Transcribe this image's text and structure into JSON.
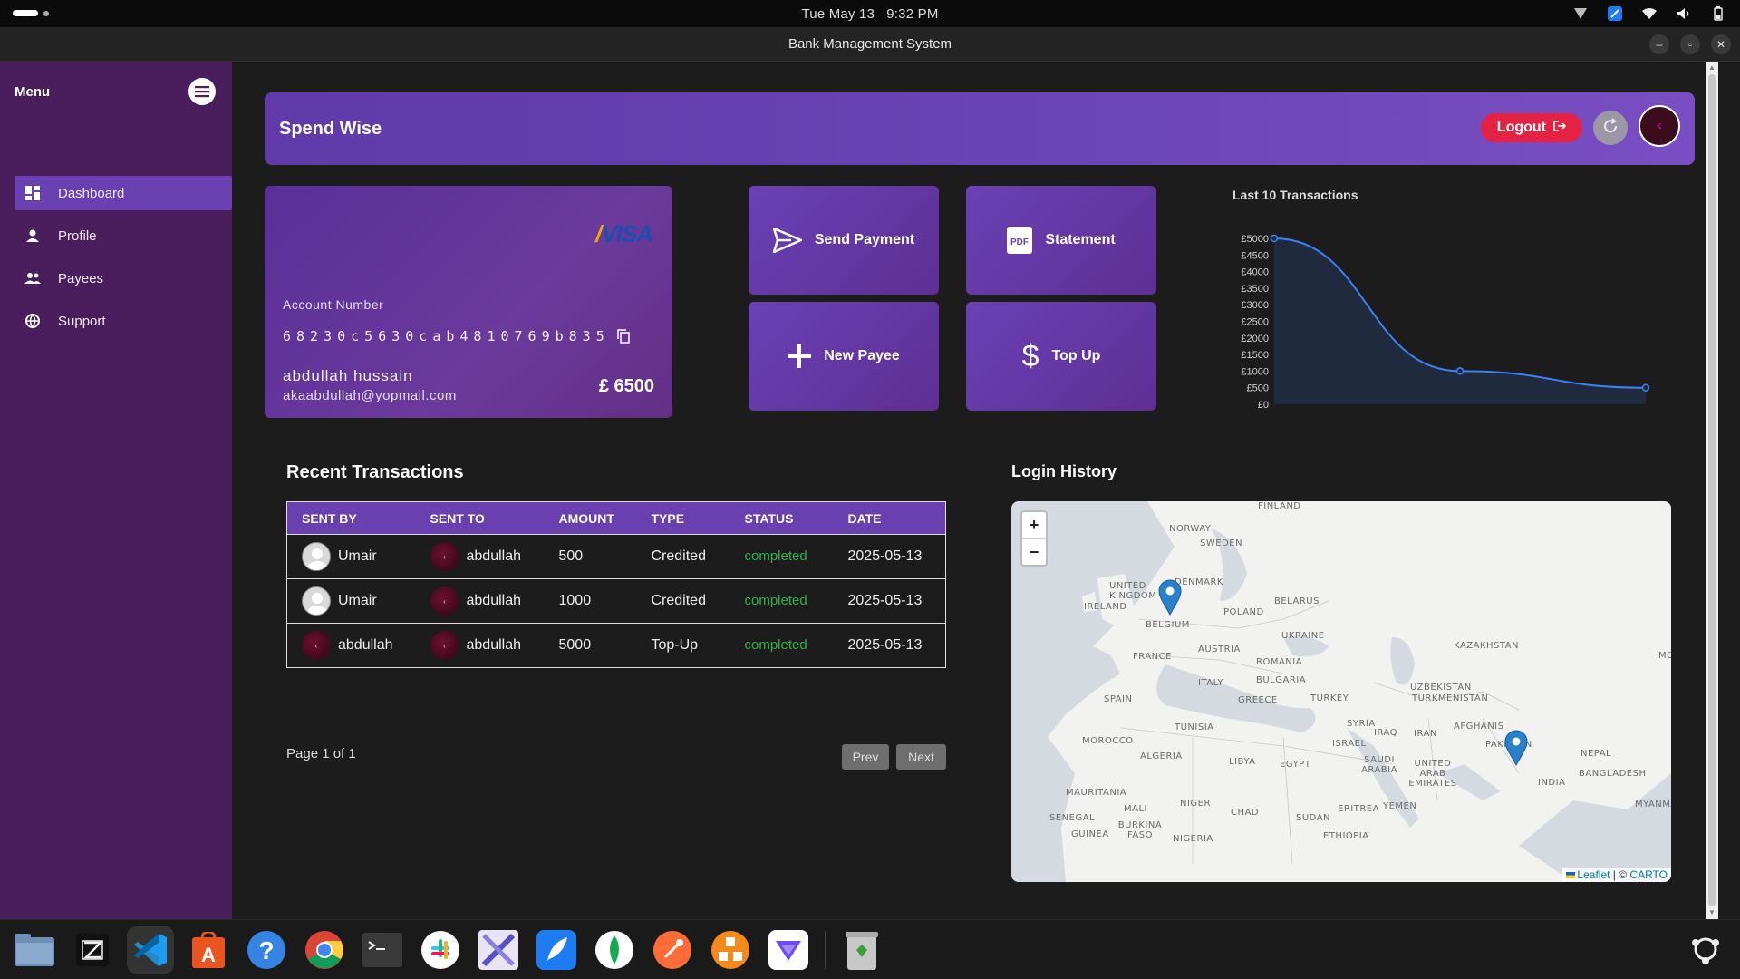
{
  "system": {
    "clock_date": "Tue May 13",
    "clock_time": "9:32 PM"
  },
  "window": {
    "title": "Bank Management System"
  },
  "sidebar": {
    "menu_label": "Menu",
    "items": [
      {
        "label": "Dashboard",
        "icon": "dashboard-icon",
        "active": true
      },
      {
        "label": "Profile",
        "icon": "person-icon"
      },
      {
        "label": "Payees",
        "icon": "people-icon"
      },
      {
        "label": "Support",
        "icon": "globe-icon"
      }
    ]
  },
  "header": {
    "brand": "Spend Wise",
    "logout_label": "Logout"
  },
  "card": {
    "network": "VISA",
    "account_label": "Account Number",
    "account_number": "68230c5630cab4810769b835",
    "holder": "abdullah hussain",
    "email": "akaabdullah@yopmail.com",
    "balance": "£ 6500"
  },
  "actions": {
    "send_payment": "Send Payment",
    "statement": "Statement",
    "new_payee": "New Payee",
    "top_up": "Top Up",
    "pdf_badge": "PDF"
  },
  "chart_data": {
    "type": "area",
    "title": "Last 10 Transactions",
    "x": [
      1,
      2,
      3
    ],
    "values": [
      5000,
      1000,
      500
    ],
    "yticks": [
      "£5000",
      "£4500",
      "£4000",
      "£3500",
      "£3000",
      "£2500",
      "£2000",
      "£1500",
      "£1000",
      "£500",
      "£0"
    ],
    "ylim": [
      0,
      5000
    ],
    "line_color": "#3b82f6",
    "fill_color": "#1f2a3f"
  },
  "transactions": {
    "title": "Recent Transactions",
    "columns": [
      "SENT BY",
      "SENT TO",
      "AMOUNT",
      "TYPE",
      "STATUS",
      "DATE"
    ],
    "rows": [
      {
        "sent_by": "Umair",
        "sent_to": "abdullah",
        "amount": "500",
        "type": "Credited",
        "status": "completed",
        "date": "2025-05-13"
      },
      {
        "sent_by": "Umair",
        "sent_to": "abdullah",
        "amount": "1000",
        "type": "Credited",
        "status": "completed",
        "date": "2025-05-13"
      },
      {
        "sent_by": "abdullah",
        "sent_to": "abdullah",
        "amount": "5000",
        "type": "Top-Up",
        "status": "completed",
        "date": "2025-05-13"
      }
    ],
    "page_info": "Page 1 of 1",
    "prev": "Prev",
    "next": "Next"
  },
  "login_history": {
    "title": "Login History",
    "zoom_in": "+",
    "zoom_out": "−",
    "attribution_leaflet": "Leaflet",
    "attribution_sep": " | © ",
    "attribution_carto": "CARTO",
    "labels": {
      "finland": "FINLAND",
      "norway": "NORWAY",
      "sweden": "SWEDEN",
      "denmark": "DENMARK",
      "united_kingdom": "UNITED KINGDOM",
      "ireland": "IRELAND",
      "belgium": "BELGIUM",
      "poland": "POLAND",
      "belarus": "BELARUS",
      "ukraine": "UKRAINE",
      "kazakhstan": "KAZAKHSTAN",
      "france": "FRANCE",
      "austria": "AUSTRIA",
      "romania": "ROMANIA",
      "italy": "ITALY",
      "bulgaria": "BULGARIA",
      "spain": "SPAIN",
      "greece": "GREECE",
      "turkey": "TURKEY",
      "uzbekistan": "UZBEKISTAN",
      "turkmenistan": "TURKMENISTAN",
      "tunisia": "TUNISIA",
      "syria": "SYRIA",
      "iraq": "IRAQ",
      "iran": "IRAN",
      "afghanistan": "AFGHANIS",
      "pakistan": "PAKISTAN",
      "morocco": "MOROCCO",
      "algeria": "ALGERIA",
      "libya": "LIBYA",
      "egypt": "EGYPT",
      "israel": "ISRAEL",
      "saudi_arabia": "SAUDI ARABIA",
      "uae": "UNITED ARAB EMIRATES",
      "nepal": "NEPAL",
      "bangladesh": "BANGLADESH",
      "india": "INDIA",
      "mauritania": "MAURITANIA",
      "mali": "MALI",
      "niger": "NIGER",
      "chad": "CHAD",
      "sudan": "SUDAN",
      "eritrea": "ERITREA",
      "yemen": "YEMEN",
      "senegal": "SENEGAL",
      "burkina": "BURKINA FASO",
      "guinea": "GUINEA",
      "nigeria": "NIGERIA",
      "ethiopia": "ETHIOPIA",
      "myanmar": "MYANMAR",
      "mo": "MO"
    },
    "marker_count": 2
  },
  "dock": {
    "apps": [
      "files-icon",
      "zed-editor-icon",
      "vscode-icon",
      "app-center-icon",
      "help-icon",
      "chrome-icon",
      "terminal-icon",
      "slack-icon",
      "kolourpaint-icon",
      "feather-icon",
      "mongodb-compass-icon",
      "postman-icon",
      "ubuntu-app-icon",
      "proton-vpn-icon",
      "trash-icon",
      "app-grid-icon"
    ]
  }
}
